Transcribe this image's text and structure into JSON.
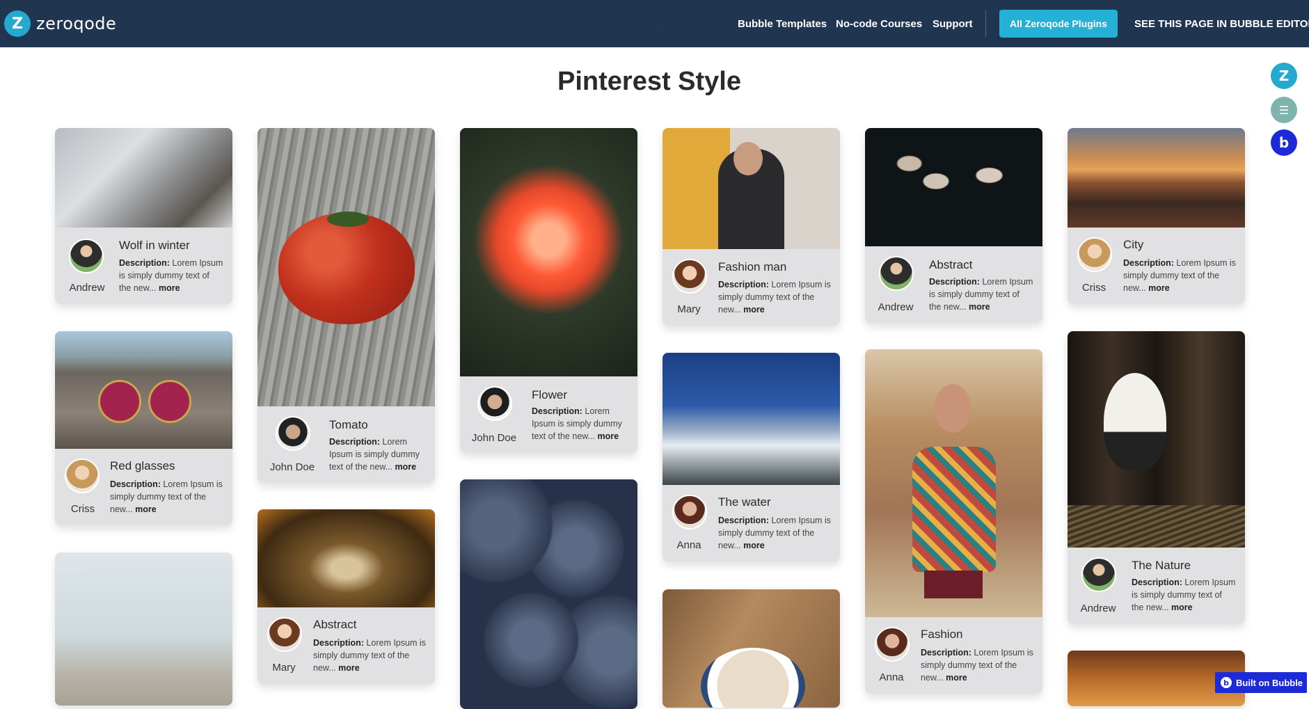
{
  "header": {
    "logo_text": "zeroqode",
    "nav": [
      "Bubble Templates",
      "No-code Courses",
      "Support"
    ],
    "plugins_button": "All Zeroqode Plugins",
    "editor_link": "SEE THIS PAGE IN BUBBLE EDITOR"
  },
  "page_title": "Pinterest Style",
  "cards": [
    {
      "title": "Wolf in winter",
      "author": "Andrew",
      "desc_label": "Description:",
      "desc_text": "Lorem Ipsum is simply dummy text of the new...",
      "more": "more"
    },
    {
      "title": "Red glasses",
      "author": "Criss",
      "desc_label": "Description:",
      "desc_text": "Lorem Ipsum is simply dummy text of the new...",
      "more": "more"
    },
    {
      "title": "Tomato",
      "author": "John Doe",
      "desc_label": "Description:",
      "desc_text": "Lorem Ipsum is simply dummy text of the new...",
      "more": "more"
    },
    {
      "title": "Abstract",
      "author": "Mary",
      "desc_label": "Description:",
      "desc_text": "Lorem Ipsum is simply dummy text of the new...",
      "more": "more"
    },
    {
      "title": "Flower",
      "author": "John Doe",
      "desc_label": "Description:",
      "desc_text": "Lorem Ipsum is simply dummy text of the new...",
      "more": "more"
    },
    {
      "title": "Fashion man",
      "author": "Mary",
      "desc_label": "Description:",
      "desc_text": "Lorem Ipsum is simply dummy text of the new...",
      "more": "more"
    },
    {
      "title": "The water",
      "author": "Anna",
      "desc_label": "Description:",
      "desc_text": "Lorem Ipsum is simply dummy text of the new...",
      "more": "more"
    },
    {
      "title": "Abstract",
      "author": "Andrew",
      "desc_label": "Description:",
      "desc_text": "Lorem Ipsum is simply dummy text of the new...",
      "more": "more"
    },
    {
      "title": "Fashion",
      "author": "Anna",
      "desc_label": "Description:",
      "desc_text": "Lorem Ipsum is simply dummy text of the new...",
      "more": "more"
    },
    {
      "title": "City",
      "author": "Criss",
      "desc_label": "Description:",
      "desc_text": "Lorem Ipsum is simply dummy text of the new...",
      "more": "more"
    },
    {
      "title": "The Nature",
      "author": "Andrew",
      "desc_label": "Description:",
      "desc_text": "Lorem Ipsum is simply dummy text of the new...",
      "more": "more"
    }
  ],
  "built_on": "Built on Bubble"
}
